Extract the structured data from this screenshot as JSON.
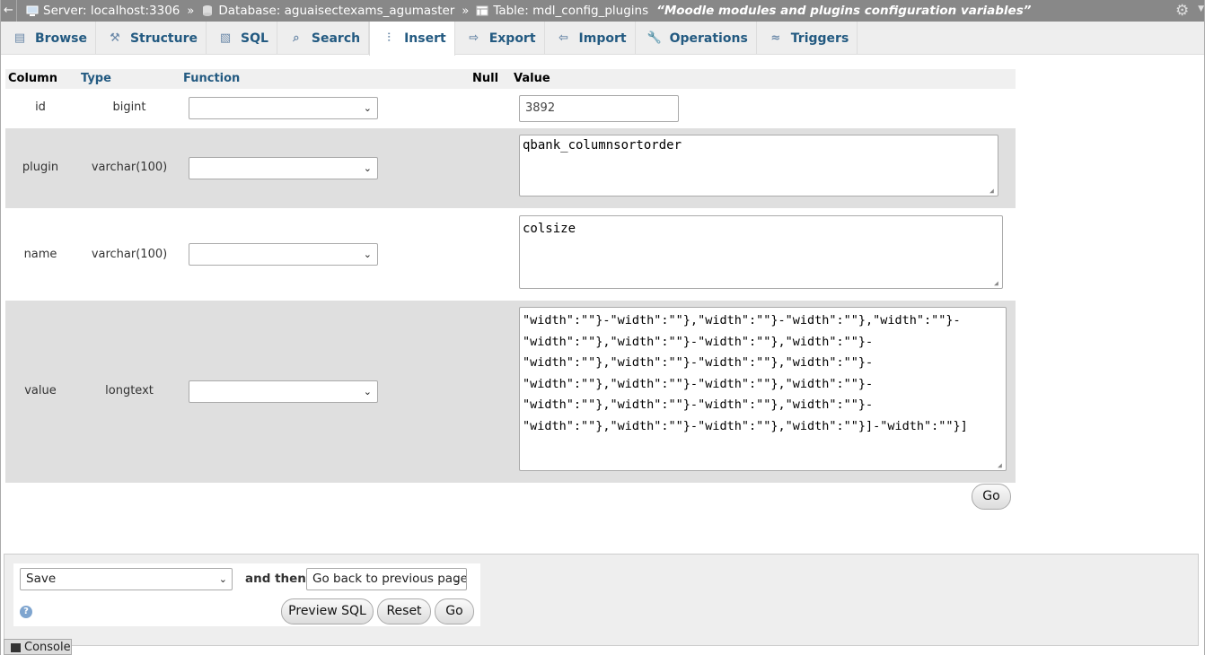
{
  "breadcrumb": {
    "server": "Server: localhost:3306",
    "database": "Database: aguaisectexams_agumaster",
    "table": "Table: mdl_config_plugins",
    "comment": "“Moodle modules and plugins configuration variables”",
    "separator": "»"
  },
  "tabs": [
    {
      "label": "Browse",
      "icon": "browse-icon"
    },
    {
      "label": "Structure",
      "icon": "structure-icon"
    },
    {
      "label": "SQL",
      "icon": "sql-icon"
    },
    {
      "label": "Search",
      "icon": "search-icon"
    },
    {
      "label": "Insert",
      "icon": "insert-icon",
      "active": true
    },
    {
      "label": "Export",
      "icon": "export-icon"
    },
    {
      "label": "Import",
      "icon": "import-icon"
    },
    {
      "label": "Operations",
      "icon": "operations-icon"
    },
    {
      "label": "Triggers",
      "icon": "triggers-icon"
    }
  ],
  "table_header": {
    "column": "Column",
    "type": "Type",
    "function": "Function",
    "null": "Null",
    "value": "Value"
  },
  "rows": [
    {
      "column": "id",
      "type": "bigint",
      "value": "3892"
    },
    {
      "column": "plugin",
      "type": "varchar(100)",
      "value": "qbank_columnsortorder"
    },
    {
      "column": "name",
      "type": "varchar(100)",
      "value": "colsize"
    },
    {
      "column": "value",
      "type": "longtext",
      "value": "\"width\":\"\"}-\"width\":\"\"},\"width\":\"\"}-\"width\":\"\"},\"width\":\"\"}-\n\"width\":\"\"},\"width\":\"\"}-\"width\":\"\"},\"width\":\"\"}-\n\"width\":\"\"},\"width\":\"\"}-\"width\":\"\"},\"width\":\"\"}-\n\"width\":\"\"},\"width\":\"\"}-\"width\":\"\"},\"width\":\"\"}-\n\"width\":\"\"},\"width\":\"\"}-\"width\":\"\"},\"width\":\"\"}-\n\"width\":\"\"},\"width\":\"\"}-\"width\":\"\"},\"width\":\"\"}]-\"width\":\"\"}]"
    }
  ],
  "go_label": "Go",
  "footer": {
    "action_select": "Save",
    "and_then": "and then",
    "after_select": "Go back to previous page",
    "preview_sql": "Preview SQL",
    "reset": "Reset",
    "go": "Go",
    "help": "?"
  },
  "console_label": "Console"
}
